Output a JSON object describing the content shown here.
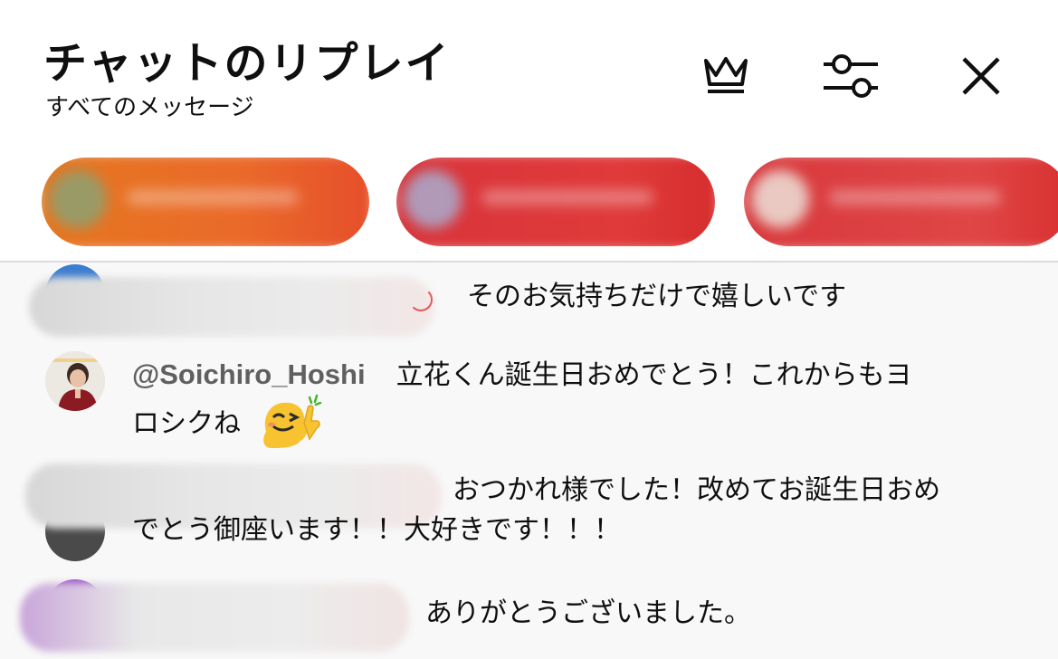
{
  "header": {
    "title": "チャットのリプレイ",
    "subtitle": "すべてのメッセージ",
    "icons": {
      "crown": "crown-icon",
      "filter": "sliders-icon",
      "close": "close-icon"
    }
  },
  "chips": [
    {
      "color": "#e8722a"
    },
    {
      "color": "#dc3939"
    },
    {
      "color": "#dc3b3b"
    }
  ],
  "messages": [
    {
      "author": "",
      "text": "そのお気持ちだけで嬉しいです"
    },
    {
      "author": "@Soichiro_Hoshi",
      "text_line1": "立花くん誕生日おめでとう！これからもヨ",
      "text_line2": "ロシクね",
      "emoji": "smiling-thumbs-up-emoji"
    },
    {
      "author": "",
      "text_line1": "おつかれ様でした！改めてお誕生日おめ",
      "text_line2": "でとう御座います！！大好きです！！！"
    },
    {
      "author": "",
      "text": "ありがとうございました。"
    }
  ],
  "colors": {
    "background": "#ffffff",
    "chat_background": "#f8f8f8",
    "author": "#606060",
    "text": "#0f0f0f"
  }
}
